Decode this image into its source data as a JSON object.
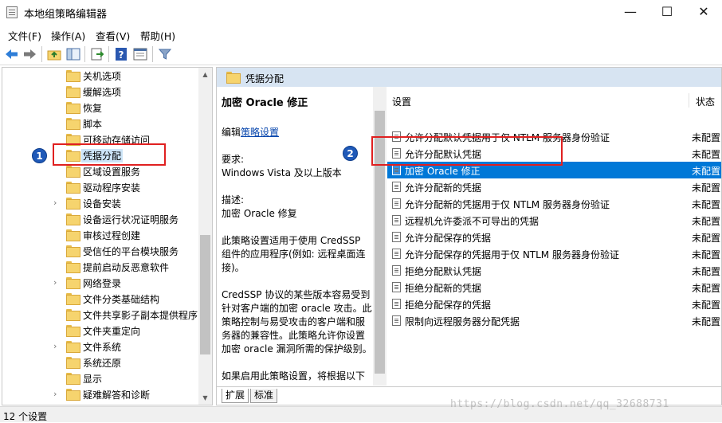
{
  "window": {
    "title": "本地组策略编辑器",
    "min": "—",
    "max": "☐",
    "close": "✕"
  },
  "menu": [
    "文件(F)",
    "操作(A)",
    "查看(V)",
    "帮助(H)"
  ],
  "tree": {
    "items": [
      {
        "label": "关机选项",
        "chev": ""
      },
      {
        "label": "缓解选项",
        "chev": ""
      },
      {
        "label": "恢复",
        "chev": ""
      },
      {
        "label": "脚本",
        "chev": ""
      },
      {
        "label": "可移动存储访问",
        "chev": ""
      },
      {
        "label": "凭据分配",
        "chev": "",
        "selected": true
      },
      {
        "label": "区域设置服务",
        "chev": ""
      },
      {
        "label": "驱动程序安装",
        "chev": ""
      },
      {
        "label": "设备安装",
        "chev": "›"
      },
      {
        "label": "设备运行状况证明服务",
        "chev": ""
      },
      {
        "label": "审核过程创建",
        "chev": ""
      },
      {
        "label": "受信任的平台模块服务",
        "chev": ""
      },
      {
        "label": "提前启动反恶意软件",
        "chev": ""
      },
      {
        "label": "网络登录",
        "chev": "›"
      },
      {
        "label": "文件分类基础结构",
        "chev": ""
      },
      {
        "label": "文件共享影子副本提供程序",
        "chev": ""
      },
      {
        "label": "文件夹重定向",
        "chev": ""
      },
      {
        "label": "文件系统",
        "chev": "›"
      },
      {
        "label": "系统还原",
        "chev": ""
      },
      {
        "label": "显示",
        "chev": ""
      },
      {
        "label": "疑难解答和诊断",
        "chev": "›"
      }
    ]
  },
  "right_header": "凭据分配",
  "description": {
    "title": "加密 Oracle 修正",
    "edit_prefix": "编辑",
    "edit_link": "策略设置",
    "req_label": "要求:",
    "req_value": "Windows Vista 及以上版本",
    "desc_label": "描述:",
    "desc_value": "加密 Oracle 修复",
    "para1": "此策略设置适用于使用 CredSSP 组件的应用程序(例如: 远程桌面连接)。",
    "para2": "CredSSP 协议的某些版本容易受到针对客户端的加密 oracle 攻击。此策略控制与易受攻击的客户端和服务器的兼容性。此策略允许你设置加密 oracle 漏洞所需的保护级别。",
    "para3": "如果启用此策略设置，将根据以下"
  },
  "list": {
    "col_setting": "设置",
    "col_state": "状态",
    "rows": [
      {
        "name": "允许分配默认凭据用于仅 NTLM 服务器身份验证",
        "state": "未配置"
      },
      {
        "name": "允许分配默认凭据",
        "state": "未配置"
      },
      {
        "name": "加密 Oracle 修正",
        "state": "未配置",
        "selected": true
      },
      {
        "name": "允许分配新的凭据",
        "state": "未配置"
      },
      {
        "name": "允许分配新的凭据用于仅 NTLM 服务器身份验证",
        "state": "未配置"
      },
      {
        "name": "远程机允许委派不可导出的凭据",
        "state": "未配置"
      },
      {
        "name": "允许分配保存的凭据",
        "state": "未配置"
      },
      {
        "name": "允许分配保存的凭据用于仅 NTLM 服务器身份验证",
        "state": "未配置"
      },
      {
        "name": "拒绝分配默认凭据",
        "state": "未配置"
      },
      {
        "name": "拒绝分配新的凭据",
        "state": "未配置"
      },
      {
        "name": "拒绝分配保存的凭据",
        "state": "未配置"
      },
      {
        "name": "限制向远程服务器分配凭据",
        "state": "未配置"
      }
    ]
  },
  "tabs": [
    "扩展",
    "标准"
  ],
  "status": "12 个设置",
  "watermark": "https://blog.csdn.net/qq_32688731",
  "annotations": [
    "1",
    "2"
  ],
  "colors": {
    "selection": "#0078d7",
    "header": "#d7e4f2",
    "annotation_box": "#e02020",
    "annotation_badge": "#1f59b8"
  }
}
